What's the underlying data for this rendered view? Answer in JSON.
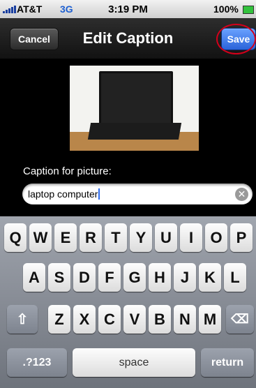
{
  "status": {
    "carrier": "AT&T",
    "network": "3G",
    "time": "3:19 PM",
    "battery": "100%"
  },
  "nav": {
    "cancel": "Cancel",
    "title": "Edit Caption",
    "save": "Save"
  },
  "form": {
    "label": "Caption for picture:",
    "value": "laptop computer"
  },
  "keyboard": {
    "row1": [
      "Q",
      "W",
      "E",
      "R",
      "T",
      "Y",
      "U",
      "I",
      "O",
      "P"
    ],
    "row2": [
      "A",
      "S",
      "D",
      "F",
      "G",
      "H",
      "J",
      "K",
      "L"
    ],
    "row3": [
      "Z",
      "X",
      "C",
      "V",
      "B",
      "N",
      "M"
    ],
    "numbers": ".?123",
    "space": "space",
    "return": "return"
  },
  "colors": {
    "save_button": "#2a63d9",
    "highlight_ring": "#d4001b"
  }
}
